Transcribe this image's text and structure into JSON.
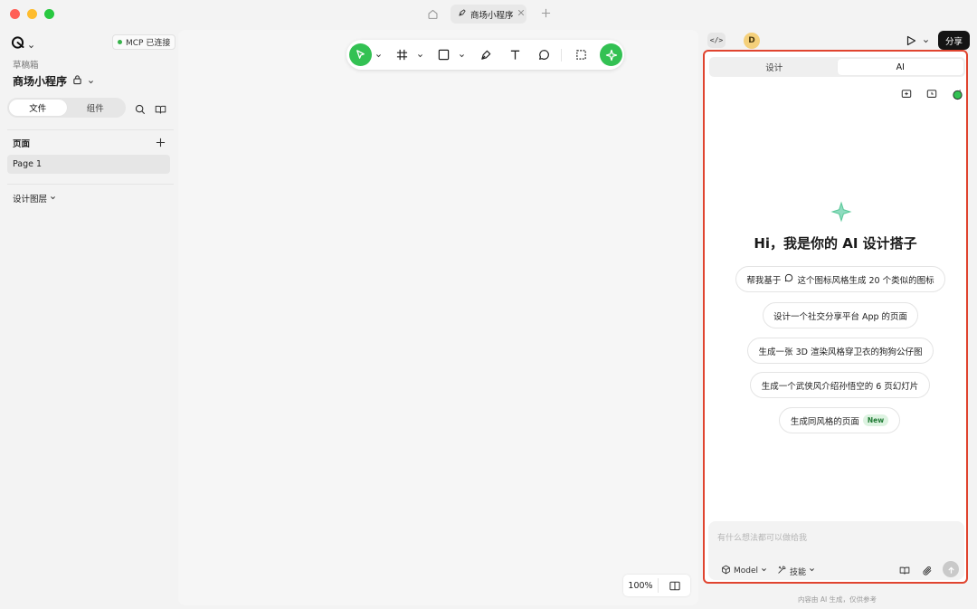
{
  "colors": {
    "accent_green": "#33c153",
    "traffic_red": "#ff5f57",
    "traffic_yellow": "#febc2e",
    "traffic_green": "#28c840",
    "highlight_border": "#e0442f",
    "mcp_status": "#36b24a"
  },
  "titlebar": {
    "home_icon": "home-icon",
    "tab_title": "商场小程序",
    "tab_icon": "pen-tool-icon",
    "tab_close_icon": "close-icon",
    "add_tab_icon": "plus-icon"
  },
  "sidebar": {
    "logo_icon": "app-logo-icon",
    "mcp_status": "MCP 已连接",
    "draft_label": "草稿箱",
    "project_name": "商场小程序",
    "tabs": [
      {
        "label": "文件",
        "active": true
      },
      {
        "label": "组件",
        "active": false
      }
    ],
    "pages_title": "页面",
    "pages": [
      {
        "label": "Page 1",
        "selected": true
      }
    ],
    "layers_title": "设计图层"
  },
  "toolbar": {
    "tools": [
      {
        "name": "select",
        "icon": "cursor-arrow-icon",
        "active": true
      },
      {
        "name": "frame",
        "icon": "frame-hash-icon"
      },
      {
        "name": "rectangle",
        "icon": "square-icon"
      },
      {
        "name": "pen",
        "icon": "pen-nib-icon"
      },
      {
        "name": "text",
        "icon": "text-t-icon"
      },
      {
        "name": "comment",
        "icon": "speech-bubble-icon"
      },
      {
        "name": "crop",
        "icon": "dashed-select-icon"
      },
      {
        "name": "ai",
        "icon": "sparkle-icon"
      }
    ]
  },
  "canvas": {
    "zoom": "100%"
  },
  "header": {
    "code_label": "</>",
    "avatar_initial": "D",
    "share_label": "分享"
  },
  "panel": {
    "tabs": [
      {
        "label": "设计",
        "active": false
      },
      {
        "label": "AI",
        "active": true
      }
    ],
    "hero_title": "Hi，我是你的 AI 设计搭子",
    "suggestions": [
      {
        "before": "帮我基于",
        "after": "这个图标风格生成 20 个类似的图标",
        "has_icon": true
      },
      {
        "text": "设计一个社交分享平台 App 的页面"
      },
      {
        "text": "生成一张 3D 渲染风格穿卫衣的狗狗公仔图"
      },
      {
        "text": "生成一个武侠风介绍孙悟空的 6 页幻灯片"
      },
      {
        "text": "生成同风格的页面",
        "badge": "New"
      }
    ],
    "chat": {
      "placeholder": "有什么想法都可以做给我",
      "model_label": "Model",
      "skill_label": "技能"
    },
    "disclaimer": "内容由 AI 生成，仅供参考"
  }
}
